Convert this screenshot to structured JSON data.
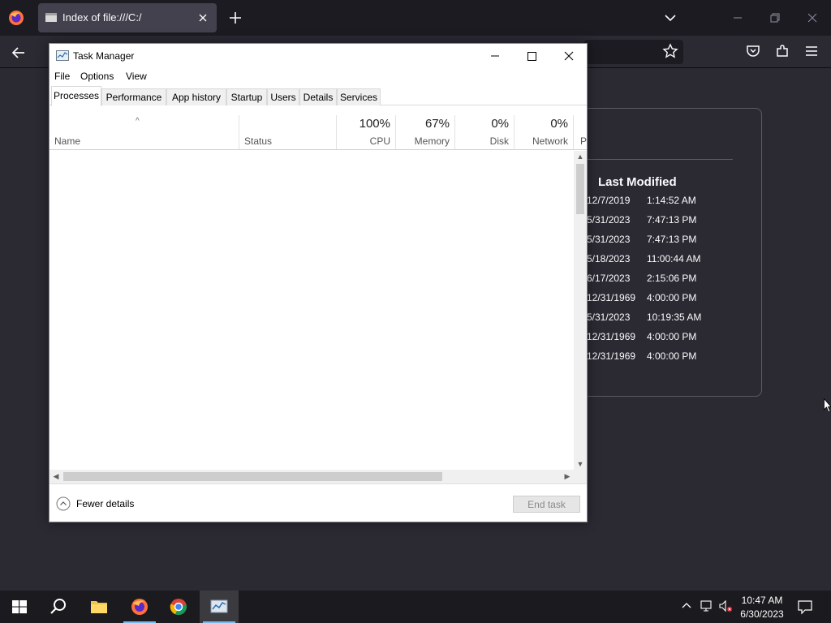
{
  "browser": {
    "tab": {
      "title": "Index of file:///C:/"
    }
  },
  "file_index": {
    "column_header": "Last Modified",
    "rows": [
      {
        "date": "12/7/2019",
        "time": "1:14:52 AM"
      },
      {
        "date": "5/31/2023",
        "time": "7:47:13 PM"
      },
      {
        "date": "5/31/2023",
        "time": "7:47:13 PM"
      },
      {
        "date": "5/18/2023",
        "time": "11:00:44 AM"
      },
      {
        "date": "6/17/2023",
        "time": "2:15:06 PM"
      },
      {
        "date": "12/31/1969",
        "time": "4:00:00 PM"
      },
      {
        "date": "5/31/2023",
        "time": "10:19:35 AM"
      },
      {
        "date": "12/31/1969",
        "time": "4:00:00 PM"
      },
      {
        "date": "12/31/1969",
        "time": "4:00:00 PM"
      }
    ]
  },
  "task_manager": {
    "title": "Task Manager",
    "menu": [
      "File",
      "Options",
      "View"
    ],
    "tabs": [
      "Processes",
      "Performance",
      "App history",
      "Startup",
      "Users",
      "Details",
      "Services"
    ],
    "active_tab": "Processes",
    "columns": {
      "name": "Name",
      "status": "Status",
      "cpu": {
        "label": "CPU",
        "value": "100%"
      },
      "memory": {
        "label": "Memory",
        "value": "67%"
      },
      "disk": {
        "label": "Disk",
        "value": "0%"
      },
      "network": {
        "label": "Network",
        "value": "0%"
      },
      "power_partial": "P"
    },
    "footer": {
      "fewer_details": "Fewer details",
      "end_task": "End task"
    }
  },
  "taskbar": {
    "clock_time": "10:47 AM",
    "clock_date": "6/30/2023"
  },
  "colors": {
    "accent": "#76b9ed",
    "browser_bg": "#2b2a33",
    "taskbar_bg": "#1b1b1f"
  }
}
